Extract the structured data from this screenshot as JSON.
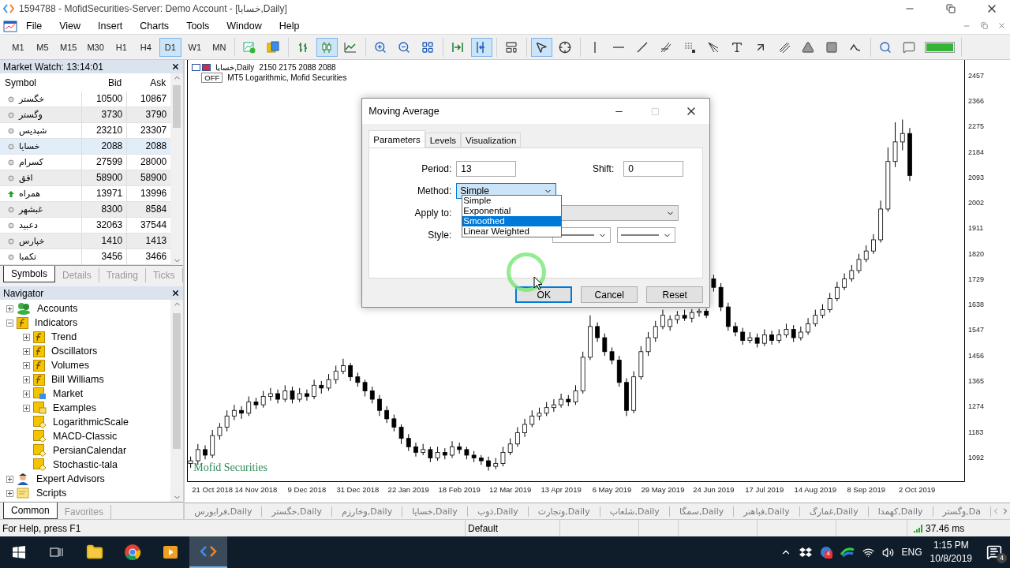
{
  "window": {
    "title": "1594788 - MofidSecurities-Server: Demo Account - [خسایا,Daily]"
  },
  "menu": [
    "File",
    "View",
    "Insert",
    "Charts",
    "Tools",
    "Window",
    "Help"
  ],
  "timeframes": [
    {
      "label": "M1",
      "selected": false
    },
    {
      "label": "M5",
      "selected": false
    },
    {
      "label": "M15",
      "selected": false
    },
    {
      "label": "M30",
      "selected": false
    },
    {
      "label": "H1",
      "selected": false
    },
    {
      "label": "H4",
      "selected": false
    },
    {
      "label": "D1",
      "selected": true
    },
    {
      "label": "W1",
      "selected": false
    },
    {
      "label": "MN",
      "selected": false
    }
  ],
  "tool_groups": [
    [
      {
        "kind": "new-chart",
        "selected": false
      },
      {
        "kind": "profiles",
        "selected": false
      }
    ],
    [
      {
        "kind": "bar-chart",
        "selected": false
      },
      {
        "kind": "candles",
        "selected": true
      },
      {
        "kind": "line-chart",
        "selected": false
      }
    ],
    [
      {
        "kind": "zoom-in",
        "selected": false
      },
      {
        "kind": "zoom-out",
        "selected": false
      },
      {
        "kind": "tile",
        "selected": false
      }
    ],
    [
      {
        "kind": "autoscroll",
        "selected": false
      },
      {
        "kind": "chart-shift",
        "selected": true
      }
    ],
    [
      {
        "kind": "templates",
        "selected": false
      }
    ],
    [
      {
        "kind": "cursor",
        "selected": true
      },
      {
        "kind": "crosshair",
        "selected": false
      }
    ],
    [
      {
        "kind": "vertical-line",
        "selected": false
      },
      {
        "kind": "horizontal-line",
        "selected": false
      },
      {
        "kind": "trend-line",
        "selected": false
      },
      {
        "kind": "fibo",
        "selected": false
      },
      {
        "kind": "grid",
        "selected": false
      },
      {
        "kind": "fan",
        "selected": false
      },
      {
        "kind": "text",
        "selected": false
      },
      {
        "kind": "arrow",
        "selected": false
      },
      {
        "kind": "parallel",
        "selected": false
      },
      {
        "kind": "triangle",
        "selected": false
      },
      {
        "kind": "rectangle",
        "selected": false
      },
      {
        "kind": "wave",
        "selected": false
      }
    ],
    [
      {
        "kind": "search",
        "selected": false
      },
      {
        "kind": "chat",
        "selected": false
      },
      {
        "kind": "signal",
        "selected": false
      }
    ]
  ],
  "market_watch": {
    "title": "Market Watch: 13:14:01",
    "columns": [
      "Symbol",
      "Bid",
      "Ask"
    ],
    "rows": [
      {
        "symbol": "خگستر",
        "bid": "10500",
        "ask": "10867",
        "rising": false,
        "selected": false
      },
      {
        "symbol": "وگستر",
        "bid": "3730",
        "ask": "3790",
        "rising": false,
        "selected": false
      },
      {
        "symbol": "شپدیس",
        "bid": "23210",
        "ask": "23307",
        "rising": false,
        "selected": false
      },
      {
        "symbol": "خسایا",
        "bid": "2088",
        "ask": "2088",
        "rising": false,
        "selected": true
      },
      {
        "symbol": "کسرام",
        "bid": "27599",
        "ask": "28000",
        "rising": false,
        "selected": false
      },
      {
        "symbol": "افق",
        "bid": "58900",
        "ask": "58900",
        "rising": false,
        "selected": false
      },
      {
        "symbol": "همراه",
        "bid": "13971",
        "ask": "13996",
        "rising": true,
        "selected": false
      },
      {
        "symbol": "غبشهر",
        "bid": "8300",
        "ask": "8584",
        "rising": false,
        "selected": false
      },
      {
        "symbol": "دعبید",
        "bid": "32063",
        "ask": "37544",
        "rising": false,
        "selected": false
      },
      {
        "symbol": "خپارس",
        "bid": "1410",
        "ask": "1413",
        "rising": false,
        "selected": false
      },
      {
        "symbol": "تکمبا",
        "bid": "3456",
        "ask": "3466",
        "rising": false,
        "selected": false
      }
    ],
    "tabs": [
      {
        "label": "Symbols",
        "selected": true
      },
      {
        "label": "Details",
        "selected": false
      },
      {
        "label": "Trading",
        "selected": false
      },
      {
        "label": "Ticks",
        "selected": false
      }
    ]
  },
  "navigator": {
    "title": "Navigator",
    "items": [
      {
        "label": "Accounts",
        "kind": "accounts",
        "expanded": false
      },
      {
        "label": "Indicators",
        "kind": "indicators",
        "expanded": true,
        "children": [
          {
            "label": "Trend",
            "kind": "indicators",
            "expanded": false
          },
          {
            "label": "Oscillators",
            "kind": "indicators",
            "expanded": false
          },
          {
            "label": "Volumes",
            "kind": "indicators",
            "expanded": false
          },
          {
            "label": "Bill Williams",
            "kind": "indicators",
            "expanded": false
          },
          {
            "label": "Market",
            "kind": "market",
            "expanded": false
          },
          {
            "label": "Examples",
            "kind": "folder",
            "expanded": false
          },
          {
            "label": "LogarithmicScale",
            "kind": "custom"
          },
          {
            "label": "MACD-Classic",
            "kind": "custom"
          },
          {
            "label": "PersianCalendar",
            "kind": "custom"
          },
          {
            "label": "Stochastic-tala",
            "kind": "custom"
          }
        ]
      },
      {
        "label": "Expert Advisors",
        "kind": "experts",
        "expanded": false
      },
      {
        "label": "Scripts",
        "kind": "scripts",
        "expanded": false
      }
    ],
    "tabs": [
      {
        "label": "Common",
        "selected": true
      },
      {
        "label": "Favorites",
        "selected": false
      }
    ]
  },
  "chart": {
    "symbol": "خسایا,Daily",
    "ohlc": "2150 2175 2088 2088",
    "toggle": "OFF",
    "indicator": "MT5 Logarithmic, Mofid Securities",
    "brand": "Mofid Securities",
    "chart_data": {
      "type": "candlestick",
      "ylim": [
        1004,
        2513
      ],
      "yticks": [
        2457,
        2366,
        2275,
        2184,
        2093,
        2002,
        1911,
        1820,
        1729,
        1638,
        1547,
        1456,
        1365,
        1274,
        1183,
        1092
      ],
      "categories": [
        null,
        null,
        null,
        "21 Oct 2018",
        null,
        null,
        null,
        null,
        null,
        "14 Nov 2018",
        null,
        null,
        null,
        null,
        null,
        null,
        "9 Dec 2018",
        null,
        null,
        null,
        null,
        null,
        null,
        "31 Dec 2018",
        null,
        null,
        null,
        null,
        null,
        null,
        "22 Jan 2019",
        null,
        null,
        null,
        null,
        null,
        null,
        "18 Feb 2019",
        null,
        null,
        null,
        null,
        null,
        null,
        "12 Mar 2019",
        null,
        null,
        null,
        null,
        null,
        null,
        "13 Apr 2019",
        null,
        null,
        null,
        null,
        null,
        null,
        "6 May 2019",
        null,
        null,
        null,
        null,
        null,
        null,
        "29 May 2019",
        null,
        null,
        null,
        null,
        null,
        null,
        "24 Jun 2019",
        null,
        null,
        null,
        null,
        null,
        null,
        "17 Jul 2019",
        null,
        null,
        null,
        null,
        null,
        null,
        "14 Aug 2019",
        null,
        null,
        null,
        null,
        null,
        null,
        "8 Sep 2019",
        null,
        null,
        null,
        null,
        null,
        null,
        "2 Oct 2019",
        null,
        null,
        null,
        null,
        null,
        null
      ],
      "ohlc": [
        [
          1070,
          1095,
          1055,
          1080
        ],
        [
          1080,
          1140,
          1065,
          1120
        ],
        [
          1120,
          1135,
          1085,
          1100
        ],
        [
          1100,
          1190,
          1090,
          1170
        ],
        [
          1170,
          1215,
          1155,
          1200
        ],
        [
          1200,
          1260,
          1185,
          1240
        ],
        [
          1240,
          1280,
          1225,
          1260
        ],
        [
          1260,
          1275,
          1230,
          1250
        ],
        [
          1250,
          1310,
          1240,
          1290
        ],
        [
          1290,
          1305,
          1265,
          1280
        ],
        [
          1280,
          1330,
          1270,
          1310
        ],
        [
          1310,
          1340,
          1295,
          1320
        ],
        [
          1320,
          1335,
          1285,
          1300
        ],
        [
          1300,
          1350,
          1290,
          1330
        ],
        [
          1330,
          1345,
          1285,
          1300
        ],
        [
          1300,
          1340,
          1290,
          1320
        ],
        [
          1320,
          1335,
          1295,
          1310
        ],
        [
          1310,
          1370,
          1300,
          1350
        ],
        [
          1350,
          1365,
          1320,
          1340
        ],
        [
          1340,
          1390,
          1330,
          1370
        ],
        [
          1370,
          1420,
          1355,
          1400
        ],
        [
          1400,
          1445,
          1390,
          1420
        ],
        [
          1420,
          1430,
          1365,
          1380
        ],
        [
          1380,
          1395,
          1345,
          1360
        ],
        [
          1360,
          1370,
          1310,
          1330
        ],
        [
          1330,
          1345,
          1285,
          1300
        ],
        [
          1300,
          1315,
          1240,
          1260
        ],
        [
          1260,
          1275,
          1215,
          1230
        ],
        [
          1230,
          1245,
          1185,
          1200
        ],
        [
          1200,
          1210,
          1140,
          1160
        ],
        [
          1160,
          1175,
          1115,
          1130
        ],
        [
          1130,
          1145,
          1095,
          1110
        ],
        [
          1110,
          1140,
          1100,
          1120
        ],
        [
          1120,
          1130,
          1075,
          1090
        ],
        [
          1090,
          1130,
          1080,
          1110
        ],
        [
          1110,
          1125,
          1085,
          1100
        ],
        [
          1100,
          1150,
          1090,
          1130
        ],
        [
          1130,
          1145,
          1105,
          1120
        ],
        [
          1120,
          1130,
          1085,
          1100
        ],
        [
          1100,
          1115,
          1075,
          1090
        ],
        [
          1090,
          1100,
          1065,
          1080
        ],
        [
          1080,
          1095,
          1045,
          1060
        ],
        [
          1060,
          1090,
          1050,
          1070
        ],
        [
          1070,
          1130,
          1060,
          1110
        ],
        [
          1110,
          1160,
          1100,
          1140
        ],
        [
          1140,
          1200,
          1130,
          1180
        ],
        [
          1180,
          1230,
          1165,
          1210
        ],
        [
          1210,
          1260,
          1200,
          1240
        ],
        [
          1240,
          1270,
          1225,
          1250
        ],
        [
          1250,
          1290,
          1240,
          1270
        ],
        [
          1270,
          1300,
          1255,
          1280
        ],
        [
          1280,
          1320,
          1270,
          1300
        ],
        [
          1300,
          1315,
          1275,
          1290
        ],
        [
          1290,
          1350,
          1280,
          1330
        ],
        [
          1330,
          1470,
          1320,
          1450
        ],
        [
          1450,
          1600,
          1440,
          1560
        ],
        [
          1560,
          1575,
          1505,
          1520
        ],
        [
          1520,
          1535,
          1455,
          1470
        ],
        [
          1470,
          1485,
          1425,
          1440
        ],
        [
          1440,
          1455,
          1345,
          1360
        ],
        [
          1360,
          1375,
          1240,
          1260
        ],
        [
          1260,
          1400,
          1250,
          1380
        ],
        [
          1380,
          1490,
          1370,
          1470
        ],
        [
          1470,
          1540,
          1455,
          1520
        ],
        [
          1520,
          1580,
          1505,
          1560
        ],
        [
          1560,
          1620,
          1550,
          1600
        ],
        [
          1560,
          1600,
          1545,
          1585
        ],
        [
          1585,
          1615,
          1570,
          1600
        ],
        [
          1600,
          1620,
          1580,
          1590
        ],
        [
          1590,
          1622,
          1575,
          1610
        ],
        [
          1610,
          1624,
          1595,
          1615
        ],
        [
          1615,
          1624,
          1590,
          1600
        ],
        [
          1730,
          1745,
          1685,
          1700
        ],
        [
          1700,
          1715,
          1615,
          1630
        ],
        [
          1630,
          1645,
          1545,
          1560
        ],
        [
          1560,
          1575,
          1525,
          1540
        ],
        [
          1540,
          1555,
          1495,
          1510
        ],
        [
          1510,
          1540,
          1500,
          1520
        ],
        [
          1520,
          1535,
          1485,
          1500
        ],
        [
          1500,
          1550,
          1490,
          1530
        ],
        [
          1530,
          1545,
          1495,
          1510
        ],
        [
          1510,
          1550,
          1500,
          1530
        ],
        [
          1530,
          1570,
          1520,
          1550
        ],
        [
          1550,
          1565,
          1505,
          1520
        ],
        [
          1520,
          1560,
          1510,
          1540
        ],
        [
          1540,
          1590,
          1530,
          1570
        ],
        [
          1570,
          1620,
          1560,
          1600
        ],
        [
          1600,
          1640,
          1590,
          1620
        ],
        [
          1620,
          1680,
          1610,
          1660
        ],
        [
          1660,
          1720,
          1650,
          1700
        ],
        [
          1700,
          1750,
          1690,
          1730
        ],
        [
          1730,
          1780,
          1720,
          1760
        ],
        [
          1760,
          1820,
          1750,
          1800
        ],
        [
          1800,
          1850,
          1790,
          1830
        ],
        [
          1830,
          1890,
          1820,
          1870
        ],
        [
          1870,
          2010,
          1860,
          1980
        ],
        [
          1980,
          2200,
          1970,
          2150
        ],
        [
          2150,
          2290,
          2130,
          2220
        ],
        [
          2220,
          2300,
          2190,
          2250
        ],
        [
          2250,
          2270,
          2080,
          2100
        ],
        null,
        null,
        null,
        null,
        null,
        null,
        null
      ]
    }
  },
  "chart_tabs": [
    "فرابورس,Daily",
    "خگستر,Daily",
    "وخارزم,Daily",
    "خسایا,Daily",
    "ذوب,Daily",
    "وتجارت,Daily",
    "شلعاب,Daily",
    "سمگا,Daily",
    "فباهنر,Daily",
    "غمارگ,Daily",
    "کهمدا,Daily",
    "وگستر,Da"
  ],
  "dialog": {
    "title": "Moving Average",
    "tabs": [
      {
        "label": "Parameters",
        "selected": true
      },
      {
        "label": "Levels",
        "selected": false
      },
      {
        "label": "Visualization",
        "selected": false
      }
    ],
    "period_label": "Period:",
    "period": "13",
    "shift_label": "Shift:",
    "shift": "0",
    "method_label": "Method:",
    "method": "Simple",
    "method_options": [
      {
        "label": "Simple",
        "selected": false
      },
      {
        "label": "Exponential",
        "selected": false
      },
      {
        "label": "Smoothed",
        "selected": true
      },
      {
        "label": "Linear Weighted",
        "selected": false
      }
    ],
    "apply_label": "Apply to:",
    "style_label": "Style:",
    "buttons": [
      {
        "label": "OK",
        "default": true
      },
      {
        "label": "Cancel",
        "default": false
      },
      {
        "label": "Reset",
        "default": false
      }
    ]
  },
  "status_bar": {
    "help": "For Help, press F1",
    "profile": "Default",
    "ping": "37.46 ms"
  },
  "taskbar": {
    "apps": [
      {
        "kind": "task-view",
        "active": false
      },
      {
        "kind": "explorer",
        "active": false
      },
      {
        "kind": "chrome",
        "active": false
      },
      {
        "kind": "player",
        "active": false
      },
      {
        "kind": "terminal",
        "active": true
      }
    ],
    "tray_badge": "4",
    "language": "ENG",
    "time": "1:15 PM",
    "date": "10/8/2019",
    "notifications": "4"
  }
}
